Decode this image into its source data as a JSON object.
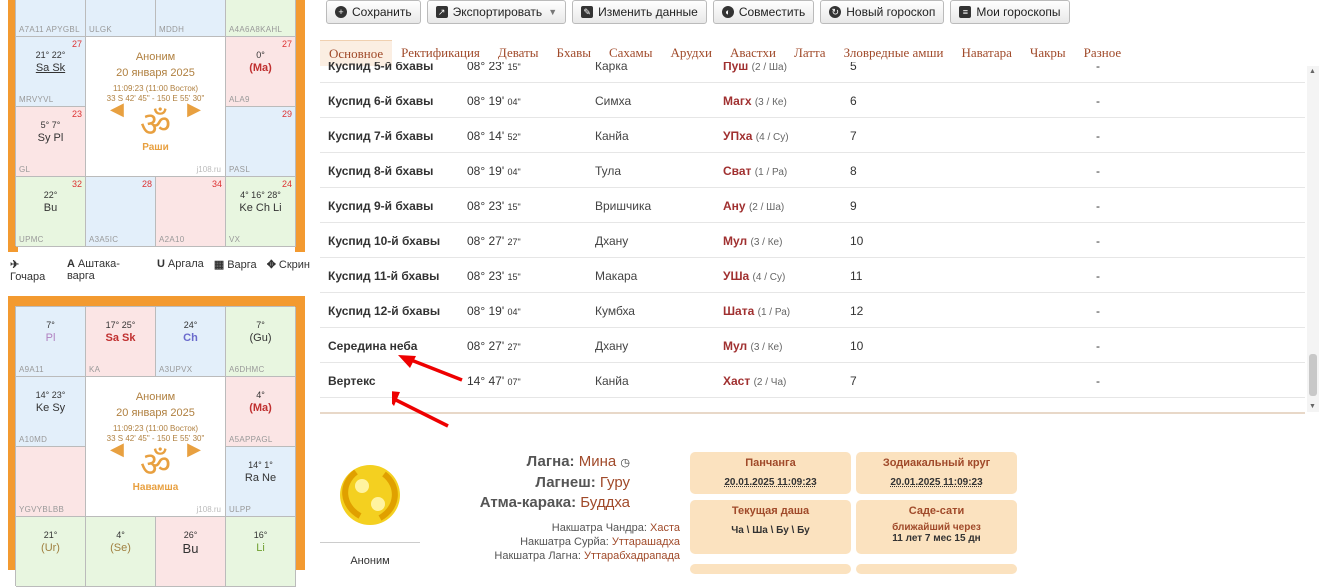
{
  "chart1": {
    "top_labels": [
      "A7A11 APYGBL",
      "ULGK",
      "MDDH",
      "A4A6A8KAHL"
    ],
    "cells": [
      {
        "num": "27",
        "planets": "21° 22°",
        "names": "Sa Sk",
        "lbl": "MRVYVL"
      },
      {
        "num": "27",
        "planets": "0°",
        "names": "(Ma)",
        "lbl": "ALA9"
      },
      {
        "num": "23",
        "planets": "5° 7°",
        "names": "Sy Pl",
        "lbl": "GL"
      },
      {
        "num": "29",
        "planets": "",
        "names": "",
        "lbl": "PASL"
      },
      {
        "num": "32",
        "planets": "22°",
        "names": "Bu",
        "lbl": "UPMC"
      },
      {
        "num": "28",
        "planets": "",
        "names": "",
        "lbl": "A3A5IC"
      },
      {
        "num": "34",
        "planets": "",
        "names": "",
        "lbl": "A2A10"
      },
      {
        "num": "24",
        "planets": "4° 16° 28°",
        "names": "Ke Ch Li",
        "lbl": "VX"
      }
    ],
    "center": {
      "name": "Аноним",
      "date": "20 января 2025",
      "time": "11:09:23 (11:00 Восток)",
      "coords": "33 S 42' 45\" - 150 E 55' 30\"",
      "om": "ॐ",
      "title": "Раши",
      "site": "j108.ru"
    }
  },
  "tools": [
    {
      "icon": "✈",
      "label": "Гочара"
    },
    {
      "icon": "A",
      "label": "Аштака-варга"
    },
    {
      "icon": "U",
      "label": "Аргала"
    },
    {
      "icon": "▦",
      "label": "Варга"
    },
    {
      "icon": "✥",
      "label": "Скрин"
    }
  ],
  "chart2": {
    "cells": [
      {
        "planets": "7°",
        "names": "Pl",
        "lbl": "A9A11"
      },
      {
        "planets": "17° 25°",
        "names": "Sa Sk",
        "lbl": "KA"
      },
      {
        "planets": "24°",
        "names": "Ch",
        "lbl": "A3UPVX"
      },
      {
        "planets": "7°",
        "names": "(Gu)",
        "lbl": "A6DHMC"
      },
      {
        "planets": "14° 23°",
        "names": "Ke Sy",
        "lbl": "A10MD"
      },
      {
        "planets": "4°",
        "names": "(Ma)",
        "lbl": "A5APPAGL"
      },
      {
        "planets": "",
        "names": "",
        "lbl": "YGVYBLBB"
      },
      {
        "planets": "14° 1°",
        "names": "Ra Ne",
        "lbl": "ULPP"
      },
      {
        "planets": "21°",
        "names": "(Ur)",
        "lbl": ""
      },
      {
        "planets": "4°",
        "names": "(Se)",
        "lbl": ""
      },
      {
        "planets": "26°",
        "names": "Bu",
        "lbl": ""
      },
      {
        "planets": "16°",
        "names": "Li",
        "lbl": ""
      }
    ],
    "center": {
      "name": "Аноним",
      "date": "20 января 2025",
      "time": "11:09:23 (11:00 Восток)",
      "coords": "33 S 42' 45\" - 150 E 55' 30\"",
      "om": "ॐ",
      "title": "Навамша",
      "site": "j108.ru"
    }
  },
  "toolbar": {
    "save": "Сохранить",
    "export": "Экспортировать",
    "edit": "Изменить данные",
    "combine": "Совместить",
    "new": "Новый гороскоп",
    "mine": "Мои гороскопы"
  },
  "tabs": [
    "Основное",
    "Ректификация",
    "Деваты",
    "Бхавы",
    "Сахамы",
    "Арудхи",
    "Авастхи",
    "Латта",
    "Зловредные амши",
    "Наватара",
    "Чакры",
    "Разное"
  ],
  "table": {
    "partial_row": {
      "name": "Куспид 5-й бхавы",
      "deg": "08° 23'",
      "sec": "15\"",
      "sign": "Карка",
      "nak": "Пуш",
      "pada": "(2 / Ша)",
      "house": "5",
      "extra": "-"
    },
    "rows": [
      {
        "name": "Куспид 6-й бхавы",
        "deg": "08° 19'",
        "sec": "04\"",
        "sign": "Симха",
        "nak": "Магх",
        "pada": "(3 / Ке)",
        "house": "6",
        "extra": "-"
      },
      {
        "name": "Куспид 7-й бхавы",
        "deg": "08° 14'",
        "sec": "52\"",
        "sign": "Канйа",
        "nak": "УПха",
        "pada": "(4 / Су)",
        "house": "7",
        "extra": "-"
      },
      {
        "name": "Куспид 8-й бхавы",
        "deg": "08° 19'",
        "sec": "04\"",
        "sign": "Тула",
        "nak": "Сват",
        "pada": "(1 / Ра)",
        "house": "8",
        "extra": "-"
      },
      {
        "name": "Куспид 9-й бхавы",
        "deg": "08° 23'",
        "sec": "15\"",
        "sign": "Вришчика",
        "nak": "Ану",
        "pada": "(2 / Ша)",
        "house": "9",
        "extra": "-"
      },
      {
        "name": "Куспид 10-й бхавы",
        "deg": "08° 27'",
        "sec": "27\"",
        "sign": "Дхану",
        "nak": "Мул",
        "pada": "(3 / Ке)",
        "house": "10",
        "extra": "-"
      },
      {
        "name": "Куспид 11-й бхавы",
        "deg": "08° 23'",
        "sec": "15\"",
        "sign": "Макара",
        "nak": "УШа",
        "pada": "(4 / Су)",
        "house": "11",
        "extra": "-"
      },
      {
        "name": "Куспид 12-й бхавы",
        "deg": "08° 19'",
        "sec": "04\"",
        "sign": "Кумбха",
        "nak": "Шата",
        "pada": "(1 / Ра)",
        "house": "12",
        "extra": "-"
      },
      {
        "name": "Середина неба",
        "deg": "08° 27'",
        "sec": "27\"",
        "sign": "Дхану",
        "nak": "Мул",
        "pada": "(3 / Ке)",
        "house": "10",
        "extra": "-"
      },
      {
        "name": "Вертекс",
        "deg": "14° 47'",
        "sec": "07\"",
        "sign": "Канйа",
        "nak": "Хаст",
        "pada": "(2 / Ча)",
        "house": "7",
        "extra": "-"
      }
    ]
  },
  "summary": {
    "name": "Аноним",
    "lagna_label": "Лагна:",
    "lagna_val": "Мина",
    "lagnesh_label": "Лагнеш:",
    "lagnesh_val": "Гуру",
    "atma_label": "Атма-карака:",
    "atma_val": "Буддха",
    "nak_moon_label": "Накшатра Чандра:",
    "nak_moon_val": "Хаста",
    "nak_sun_label": "Накшатра Сурйа:",
    "nak_sun_val": "Уттарашадха",
    "nak_lagna_label": "Накшатра Лагна:",
    "nak_lagna_val": "Уттарабхадрапада"
  },
  "cards": {
    "panchang_title": "Панчанга",
    "panchang_sub": "20.01.2025 11:09:23",
    "zodiac_title": "Зодиакальный круг",
    "zodiac_sub": "20.01.2025 11:09:23",
    "dasha_title": "Текущая даша",
    "dasha_sub": "Ча \\ Ша \\ Бу \\ Бу",
    "sade_title": "Саде-сати",
    "sade_sub": "ближайший через",
    "sade_sub2": "11 лет 7 мес 15 дн"
  }
}
